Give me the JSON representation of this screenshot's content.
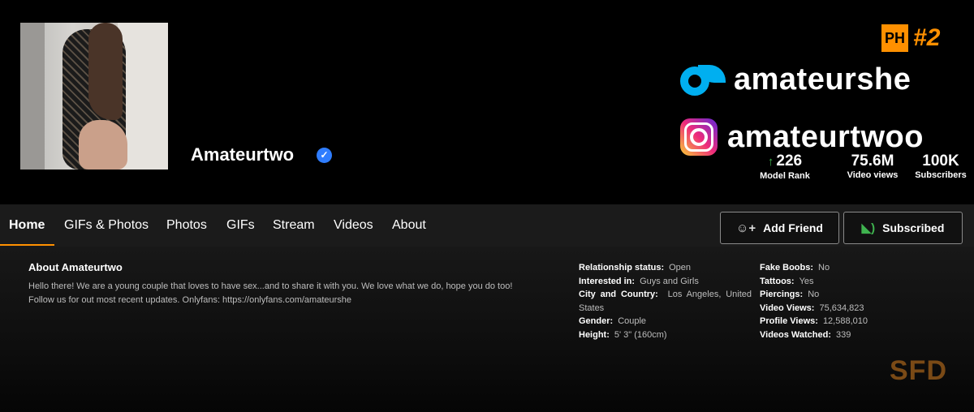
{
  "profile": {
    "name": "Amateurtwo",
    "verified_glyph": "✓"
  },
  "rank_badge": {
    "ph": "PH",
    "number": "#2"
  },
  "socials": {
    "onlyfans_handle": "amateurshe",
    "instagram_handle": "amateurtwoo"
  },
  "stats": [
    {
      "value": "226",
      "label": "Model Rank"
    },
    {
      "value": "75.6M",
      "label": "Video views"
    },
    {
      "value": "100K",
      "label": "Subscribers"
    }
  ],
  "nav": {
    "tabs": [
      "Home",
      "GIFs & Photos",
      "Photos",
      "GIFs",
      "Stream",
      "Videos",
      "About"
    ],
    "active_tab": "Home",
    "add_friend_label": "Add Friend",
    "subscribed_label": "Subscribed"
  },
  "about": {
    "title": "About Amateurtwo",
    "text": "Hello there! We are a young couple that loves to have sex...and to share it with you. We love what we do, hope you do too! Follow us for out most recent updates. Onlyfans: https://onlyfans.com/amateurshe"
  },
  "details_left": [
    {
      "key": "Relationship status:",
      "value": "Open"
    },
    {
      "key": "Interested in:",
      "value": "Guys and Girls"
    },
    {
      "key": "City and Country:",
      "value": "Los Angeles, United States"
    },
    {
      "key": "Gender:",
      "value": "Couple"
    },
    {
      "key": "Height:",
      "value": "5' 3\" (160cm)"
    }
  ],
  "details_right": [
    {
      "key": "Fake Boobs:",
      "value": "No"
    },
    {
      "key": "Tattoos:",
      "value": "Yes"
    },
    {
      "key": "Piercings:",
      "value": "No"
    },
    {
      "key": "Video Views:",
      "value": "75,634,823"
    },
    {
      "key": "Profile Views:",
      "value": "12,588,010"
    },
    {
      "key": "Videos Watched:",
      "value": "339"
    }
  ],
  "watermark": "SFD",
  "colors": {
    "accent": "#ff9000",
    "onlyfans_blue": "#00aff0",
    "verified_blue": "#2f7dff",
    "rss_green": "#3fb34f"
  },
  "icons": {
    "add_friend": "add-user-icon",
    "subscribed": "rss-icon",
    "rank_up": "arrow-up-icon"
  }
}
